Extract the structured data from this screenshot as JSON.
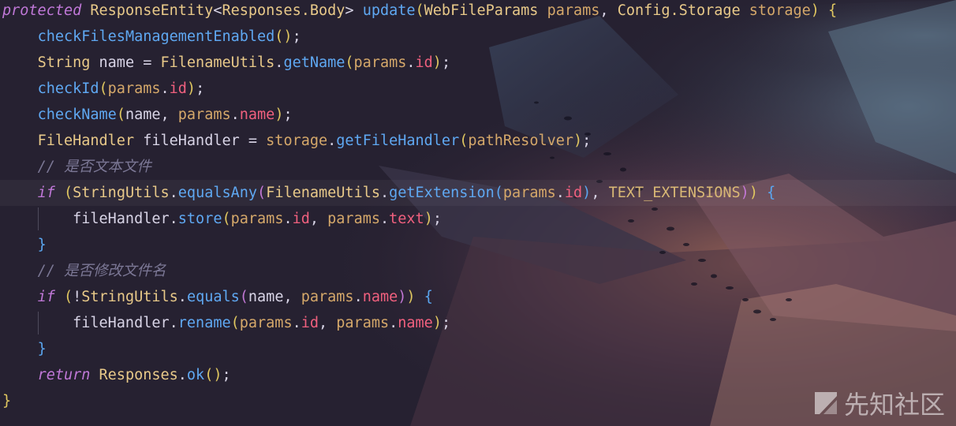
{
  "editor": {
    "lines": [
      {
        "tokens": [
          {
            "t": "protected",
            "c": "kw"
          },
          {
            "t": " ",
            "c": "text"
          },
          {
            "t": "ResponseEntity",
            "c": "type"
          },
          {
            "t": "<",
            "c": "gen"
          },
          {
            "t": "Responses.Body",
            "c": "type"
          },
          {
            "t": ">",
            "c": "gen"
          },
          {
            "t": " ",
            "c": "text"
          },
          {
            "t": "update",
            "c": "fn"
          },
          {
            "t": "(",
            "c": "paren"
          },
          {
            "t": "WebFileParams",
            "c": "type"
          },
          {
            "t": " ",
            "c": "text"
          },
          {
            "t": "params",
            "c": "param"
          },
          {
            "t": ", ",
            "c": "punc"
          },
          {
            "t": "Config.Storage",
            "c": "type"
          },
          {
            "t": " ",
            "c": "text"
          },
          {
            "t": "storage",
            "c": "param"
          },
          {
            "t": ")",
            "c": "paren"
          },
          {
            "t": " ",
            "c": "text"
          },
          {
            "t": "{",
            "c": "brace1"
          }
        ]
      },
      {
        "tokens": [
          {
            "t": "    ",
            "c": "text"
          },
          {
            "t": "checkFilesManagementEnabled",
            "c": "fn"
          },
          {
            "t": "()",
            "c": "paren"
          },
          {
            "t": ";",
            "c": "punc"
          }
        ]
      },
      {
        "tokens": [
          {
            "t": "    ",
            "c": "text"
          },
          {
            "t": "String",
            "c": "type"
          },
          {
            "t": " name = ",
            "c": "text"
          },
          {
            "t": "FilenameUtils",
            "c": "type"
          },
          {
            "t": ".",
            "c": "punc"
          },
          {
            "t": "getName",
            "c": "fn"
          },
          {
            "t": "(",
            "c": "paren"
          },
          {
            "t": "params",
            "c": "param"
          },
          {
            "t": ".",
            "c": "punc"
          },
          {
            "t": "id",
            "c": "field"
          },
          {
            "t": ")",
            "c": "paren"
          },
          {
            "t": ";",
            "c": "punc"
          }
        ]
      },
      {
        "tokens": [
          {
            "t": "    ",
            "c": "text"
          },
          {
            "t": "checkId",
            "c": "fn"
          },
          {
            "t": "(",
            "c": "paren"
          },
          {
            "t": "params",
            "c": "param"
          },
          {
            "t": ".",
            "c": "punc"
          },
          {
            "t": "id",
            "c": "field"
          },
          {
            "t": ")",
            "c": "paren"
          },
          {
            "t": ";",
            "c": "punc"
          }
        ]
      },
      {
        "tokens": [
          {
            "t": "    ",
            "c": "text"
          },
          {
            "t": "checkName",
            "c": "fn"
          },
          {
            "t": "(",
            "c": "paren"
          },
          {
            "t": "name, ",
            "c": "text"
          },
          {
            "t": "params",
            "c": "param"
          },
          {
            "t": ".",
            "c": "punc"
          },
          {
            "t": "name",
            "c": "field"
          },
          {
            "t": ")",
            "c": "paren"
          },
          {
            "t": ";",
            "c": "punc"
          }
        ]
      },
      {
        "tokens": [
          {
            "t": "    ",
            "c": "text"
          },
          {
            "t": "FileHandler",
            "c": "type"
          },
          {
            "t": " fileHandler = ",
            "c": "text"
          },
          {
            "t": "storage",
            "c": "param"
          },
          {
            "t": ".",
            "c": "punc"
          },
          {
            "t": "getFileHandler",
            "c": "fn"
          },
          {
            "t": "(",
            "c": "paren"
          },
          {
            "t": "pathResolver",
            "c": "param"
          },
          {
            "t": ")",
            "c": "paren"
          },
          {
            "t": ";",
            "c": "punc"
          }
        ]
      },
      {
        "tokens": [
          {
            "t": "    ",
            "c": "text"
          },
          {
            "t": "// 是否文本文件",
            "c": "comment"
          }
        ]
      },
      {
        "current": true,
        "tokens": [
          {
            "t": "    ",
            "c": "text"
          },
          {
            "t": "if",
            "c": "kw"
          },
          {
            "t": " ",
            "c": "text"
          },
          {
            "t": "(",
            "c": "paren"
          },
          {
            "t": "StringUtils",
            "c": "type"
          },
          {
            "t": ".",
            "c": "punc"
          },
          {
            "t": "equalsAny",
            "c": "fn"
          },
          {
            "t": "(",
            "c": "brace2"
          },
          {
            "t": "FilenameUtils",
            "c": "type"
          },
          {
            "t": ".",
            "c": "punc"
          },
          {
            "t": "getExtension",
            "c": "fn"
          },
          {
            "t": "(",
            "c": "brace3"
          },
          {
            "t": "params",
            "c": "param"
          },
          {
            "t": ".",
            "c": "punc"
          },
          {
            "t": "id",
            "c": "field"
          },
          {
            "t": ")",
            "c": "brace3"
          },
          {
            "t": ", ",
            "c": "punc"
          },
          {
            "t": "TEXT_EXTENSIONS",
            "c": "const"
          },
          {
            "t": ")",
            "c": "brace2"
          },
          {
            "t": ")",
            "c": "paren"
          },
          {
            "t": " ",
            "c": "text"
          },
          {
            "t": "{",
            "c": "brace3"
          }
        ]
      },
      {
        "tokens": [
          {
            "t": "        ",
            "c": "text"
          },
          {
            "t": "fileHandler",
            "c": "text"
          },
          {
            "t": ".",
            "c": "punc"
          },
          {
            "t": "store",
            "c": "fn"
          },
          {
            "t": "(",
            "c": "paren"
          },
          {
            "t": "params",
            "c": "param"
          },
          {
            "t": ".",
            "c": "punc"
          },
          {
            "t": "id",
            "c": "field"
          },
          {
            "t": ", ",
            "c": "punc"
          },
          {
            "t": "params",
            "c": "param"
          },
          {
            "t": ".",
            "c": "punc"
          },
          {
            "t": "text",
            "c": "field"
          },
          {
            "t": ")",
            "c": "paren"
          },
          {
            "t": ";",
            "c": "punc"
          }
        ]
      },
      {
        "tokens": [
          {
            "t": "    ",
            "c": "text"
          },
          {
            "t": "}",
            "c": "brace3"
          }
        ]
      },
      {
        "tokens": [
          {
            "t": "    ",
            "c": "text"
          },
          {
            "t": "// 是否修改文件名",
            "c": "comment"
          }
        ]
      },
      {
        "tokens": [
          {
            "t": "    ",
            "c": "text"
          },
          {
            "t": "if",
            "c": "kw"
          },
          {
            "t": " ",
            "c": "text"
          },
          {
            "t": "(",
            "c": "paren"
          },
          {
            "t": "!",
            "c": "punc"
          },
          {
            "t": "StringUtils",
            "c": "type"
          },
          {
            "t": ".",
            "c": "punc"
          },
          {
            "t": "equals",
            "c": "fn"
          },
          {
            "t": "(",
            "c": "brace2"
          },
          {
            "t": "name, ",
            "c": "text"
          },
          {
            "t": "params",
            "c": "param"
          },
          {
            "t": ".",
            "c": "punc"
          },
          {
            "t": "name",
            "c": "field"
          },
          {
            "t": ")",
            "c": "brace2"
          },
          {
            "t": ")",
            "c": "paren"
          },
          {
            "t": " ",
            "c": "text"
          },
          {
            "t": "{",
            "c": "brace3"
          }
        ]
      },
      {
        "tokens": [
          {
            "t": "        ",
            "c": "text"
          },
          {
            "t": "fileHandler",
            "c": "text"
          },
          {
            "t": ".",
            "c": "punc"
          },
          {
            "t": "rename",
            "c": "fn"
          },
          {
            "t": "(",
            "c": "paren"
          },
          {
            "t": "params",
            "c": "param"
          },
          {
            "t": ".",
            "c": "punc"
          },
          {
            "t": "id",
            "c": "field"
          },
          {
            "t": ", ",
            "c": "punc"
          },
          {
            "t": "params",
            "c": "param"
          },
          {
            "t": ".",
            "c": "punc"
          },
          {
            "t": "name",
            "c": "field"
          },
          {
            "t": ")",
            "c": "paren"
          },
          {
            "t": ";",
            "c": "punc"
          }
        ]
      },
      {
        "tokens": [
          {
            "t": "    ",
            "c": "text"
          },
          {
            "t": "}",
            "c": "brace3"
          }
        ]
      },
      {
        "tokens": [
          {
            "t": "    ",
            "c": "text"
          },
          {
            "t": "return",
            "c": "kw"
          },
          {
            "t": " ",
            "c": "text"
          },
          {
            "t": "Responses",
            "c": "type"
          },
          {
            "t": ".",
            "c": "punc"
          },
          {
            "t": "ok",
            "c": "fn"
          },
          {
            "t": "()",
            "c": "paren"
          },
          {
            "t": ";",
            "c": "punc"
          }
        ]
      },
      {
        "tokens": [
          {
            "t": "}",
            "c": "brace1"
          }
        ]
      }
    ]
  },
  "watermark": {
    "text": "先知社区",
    "icon": "xianzhi-logo-icon"
  }
}
